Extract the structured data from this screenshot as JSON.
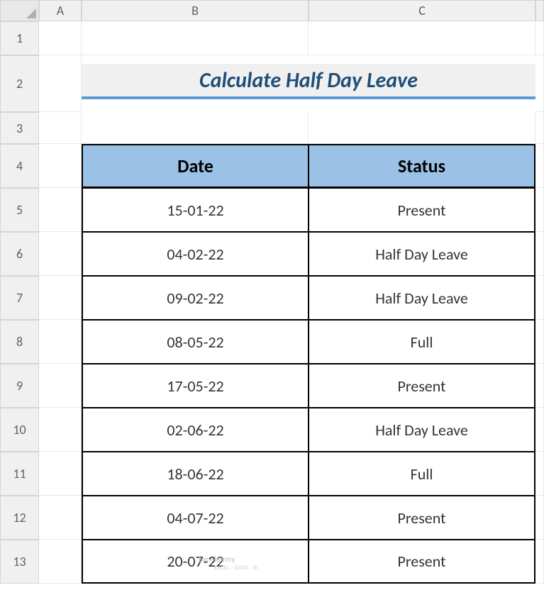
{
  "columns": [
    "A",
    "B",
    "C"
  ],
  "rows": [
    "1",
    "2",
    "3",
    "4",
    "5",
    "6",
    "7",
    "8",
    "9",
    "10",
    "11",
    "12",
    "13"
  ],
  "title": "Calculate Half Day Leave",
  "table": {
    "headers": {
      "date": "Date",
      "status": "Status"
    },
    "rows": [
      {
        "date": "15-01-22",
        "status": "Present"
      },
      {
        "date": "04-02-22",
        "status": "Half Day Leave"
      },
      {
        "date": "09-02-22",
        "status": "Half Day Leave"
      },
      {
        "date": "08-05-22",
        "status": "Full"
      },
      {
        "date": "17-05-22",
        "status": "Present"
      },
      {
        "date": "02-06-22",
        "status": "Half Day Leave"
      },
      {
        "date": "18-06-22",
        "status": "Full"
      },
      {
        "date": "04-07-22",
        "status": "Present"
      },
      {
        "date": "20-07-22",
        "status": "Present"
      }
    ]
  },
  "watermark": {
    "main": "Exceldemy",
    "sub": "EXCEL · DATA · BI"
  }
}
